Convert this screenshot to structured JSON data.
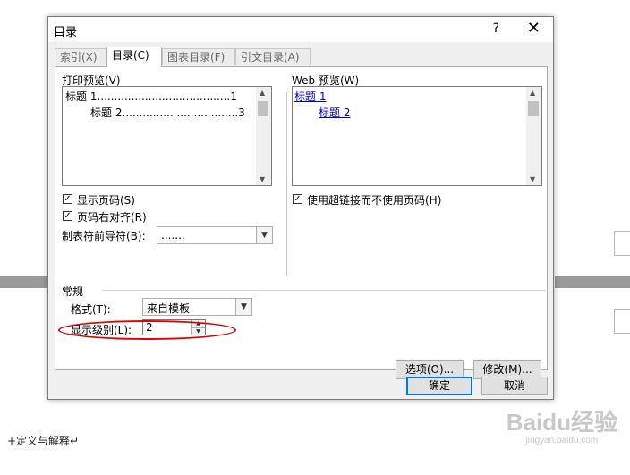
{
  "dialog": {
    "title": "目录",
    "help": "?",
    "close": "✕"
  },
  "tabs": [
    "索引(X)",
    "目录(C)",
    "图表目录(F)",
    "引文目录(A)"
  ],
  "print_preview": {
    "label": "打印预览(V)",
    "lines": [
      "标题 1.......................................1",
      "标题 2..................................3"
    ]
  },
  "web_preview": {
    "label": "Web 预览(W)",
    "links": [
      "标题 1",
      "标题 2"
    ]
  },
  "options": {
    "show_page_numbers": "显示页码(S)",
    "right_align": "页码右对齐(R)",
    "tab_leader_label": "制表符前导符(B):",
    "tab_leader_value": ".......",
    "use_hyperlinks": "使用超链接而不使用页码(H)"
  },
  "general": {
    "heading": "常规",
    "format_label": "格式(T):",
    "format_value": "来自模板",
    "levels_label": "显示级别(L):",
    "levels_value": "2"
  },
  "buttons": {
    "options": "选项(O)...",
    "modify": "修改(M)...",
    "ok": "确定",
    "cancel": "取消"
  },
  "document": {
    "text": "+定义与解释↵"
  },
  "watermark": {
    "main": "Baidu经验",
    "sub": "jingyan.baidu.com"
  },
  "colors": {
    "link": "#0000d0",
    "highlight_ellipse": "#e00000",
    "default_button_border": "#0078d7"
  }
}
